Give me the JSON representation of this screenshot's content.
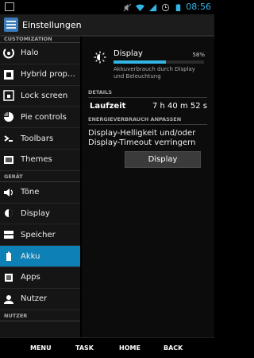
{
  "status_bar": {
    "time": "08:56",
    "icons": [
      "notification-icon",
      "mute-icon",
      "wifi-icon",
      "signal-icon",
      "alarm-icon",
      "battery-icon"
    ]
  },
  "action_bar": {
    "title": "Einstellungen",
    "icon": "settings-icon"
  },
  "sidebar": {
    "section_customization": "CUSTOMIZATION",
    "items": [
      {
        "label": "Halo",
        "icon": "halo-icon"
      },
      {
        "label": "Hybrid propert..",
        "icon": "hybrid-icon"
      },
      {
        "label": "Lock screen",
        "icon": "lock-screen-icon"
      },
      {
        "label": "Pie controls",
        "icon": "pie-icon"
      },
      {
        "label": "Toolbars",
        "icon": "toolbars-icon"
      },
      {
        "label": "Themes",
        "icon": "themes-icon"
      }
    ],
    "section_device": "GERÄT",
    "device_items": [
      {
        "label": "Töne",
        "icon": "volume-icon"
      },
      {
        "label": "Display",
        "icon": "display-icon"
      },
      {
        "label": "Speicher",
        "icon": "storage-icon"
      },
      {
        "label": "Akku",
        "icon": "battery-icon",
        "selected": true
      },
      {
        "label": "Apps",
        "icon": "apps-icon"
      },
      {
        "label": "Nutzer",
        "icon": "user-icon"
      }
    ],
    "section_user": "NUTZER"
  },
  "detail": {
    "usage_item": {
      "name": "Display",
      "percent": "58%",
      "level": 0.58,
      "description": "Akkuverbrauch durch Display und Beleuchtung"
    },
    "details_header": "DETAILS",
    "runtime_label": "Laufzeit",
    "runtime_value": "7 h 40 m 52 s",
    "adjust_header": "ENERGIEVERBRAUCH ANPASSEN",
    "hint": "Display-Helligkeit und/oder Display-Timeout verringern",
    "button_label": "Display"
  },
  "nav": {
    "menu": "MENU",
    "task": "TASK",
    "home": "HOME",
    "back": "BACK"
  },
  "colors": {
    "accent": "#33b5e5",
    "selected": "#0d81b5"
  }
}
